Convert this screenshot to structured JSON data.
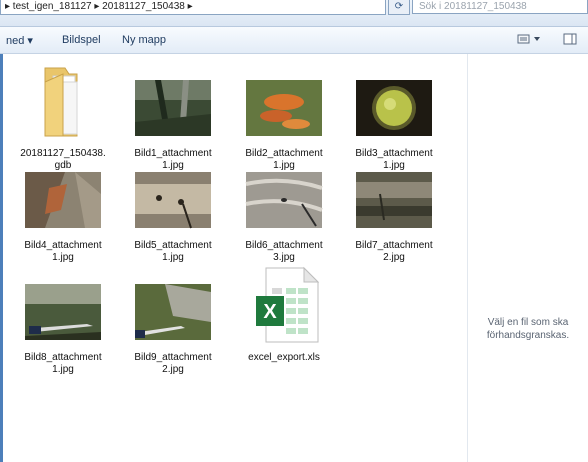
{
  "address": {
    "path": "▸ test_igen_181127 ▸ 20181127_150438 ▸"
  },
  "search": {
    "placeholder": "Sök i 20181127_150438"
  },
  "toolbar": {
    "partial_label": "ned ▾",
    "slideshow": "Bildspel",
    "new_folder": "Ny mapp",
    "view_icon": "view-icon",
    "pane_icon": "preview-pane-icon"
  },
  "files": [
    {
      "name": "20181127_150438.\ngdb",
      "kind": "folder"
    },
    {
      "name": "Bild1_attachment\n1.jpg",
      "kind": "image",
      "colors": [
        "#3b4a34",
        "#8a8f84",
        "#1f2a1d"
      ]
    },
    {
      "name": "Bild2_attachment\n1.jpg",
      "kind": "image",
      "colors": [
        "#556b3a",
        "#d9742c",
        "#7a8a4a"
      ]
    },
    {
      "name": "Bild3_attachment\n1.jpg",
      "kind": "image",
      "colors": [
        "#1e1a12",
        "#b9c24a",
        "#5a5a2a"
      ]
    },
    {
      "name": "Bild4_attachment\n1.jpg",
      "kind": "image",
      "colors": [
        "#6b5a48",
        "#b0643a",
        "#8c8372"
      ]
    },
    {
      "name": "Bild5_attachment\n1.jpg",
      "kind": "image",
      "colors": [
        "#8a8070",
        "#c4b9a4",
        "#2a241c"
      ]
    },
    {
      "name": "Bild6_attachment\n3.jpg",
      "kind": "image",
      "colors": [
        "#9e9a92",
        "#d8d4cc",
        "#2a2a2a"
      ]
    },
    {
      "name": "Bild7_attachment\n2.jpg",
      "kind": "image",
      "colors": [
        "#5c5a4a",
        "#8e8878",
        "#3a3a2e"
      ]
    },
    {
      "name": "Bild8_attachment\n1.jpg",
      "kind": "image",
      "colors": [
        "#4a5a3c",
        "#9aa08c",
        "#2a3020"
      ]
    },
    {
      "name": "Bild9_attachment\n2.jpg",
      "kind": "image",
      "colors": [
        "#5a6a3c",
        "#a8a89c",
        "#3a4428"
      ]
    },
    {
      "name": "excel_export.xls",
      "kind": "excel"
    }
  ],
  "preview": {
    "text": "Välj en fil som ska\nförhandsgranskas."
  },
  "colors": {
    "accent": "#4d7fba",
    "excel_green": "#1f7a3d"
  }
}
